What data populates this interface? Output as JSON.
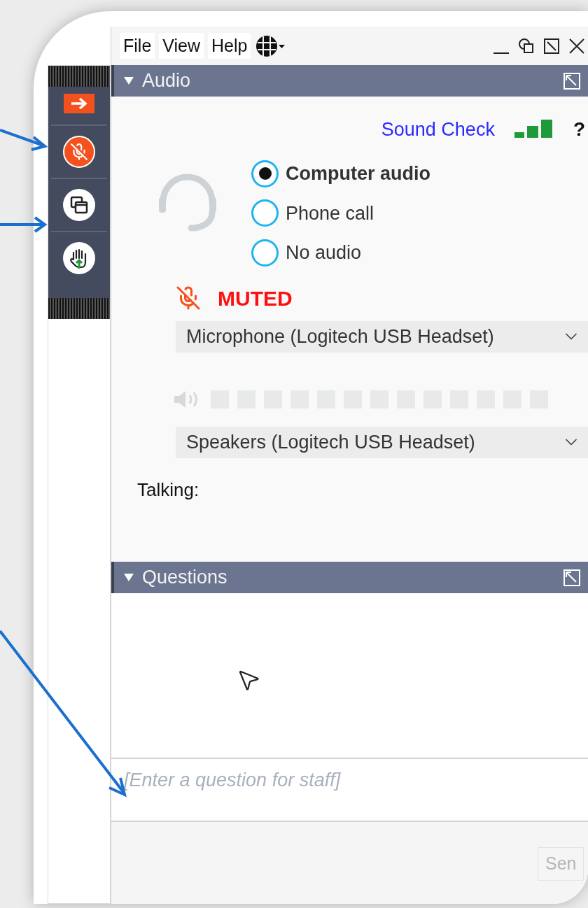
{
  "menu": [
    {
      "label": "File"
    },
    {
      "label": "View"
    },
    {
      "label": "Help"
    }
  ],
  "toolbar": [
    {
      "kind": "collapse"
    },
    {
      "kind": "mic",
      "muted": true
    },
    {
      "kind": "screen"
    },
    {
      "kind": "hand"
    }
  ],
  "audio_panel": {
    "title": "Audio",
    "expanded": true,
    "sound_check": "Sound Check",
    "help": "?",
    "options": [
      {
        "label": "Computer audio",
        "selected": true
      },
      {
        "label": "Phone call",
        "selected": false
      },
      {
        "label": "No audio",
        "selected": false
      }
    ],
    "mic_status": "MUTED",
    "microphone": "Microphone (Logitech USB Headset)",
    "speaker_meter": {
      "level": 0
    },
    "speakers": "Speakers (Logitech USB Headset)",
    "talking": "Talking:"
  },
  "questions_panel": {
    "title": "Questions",
    "expanded": true,
    "input": {
      "placeholder": "[Enter a question for staff]"
    },
    "send_button": "Sen"
  }
}
